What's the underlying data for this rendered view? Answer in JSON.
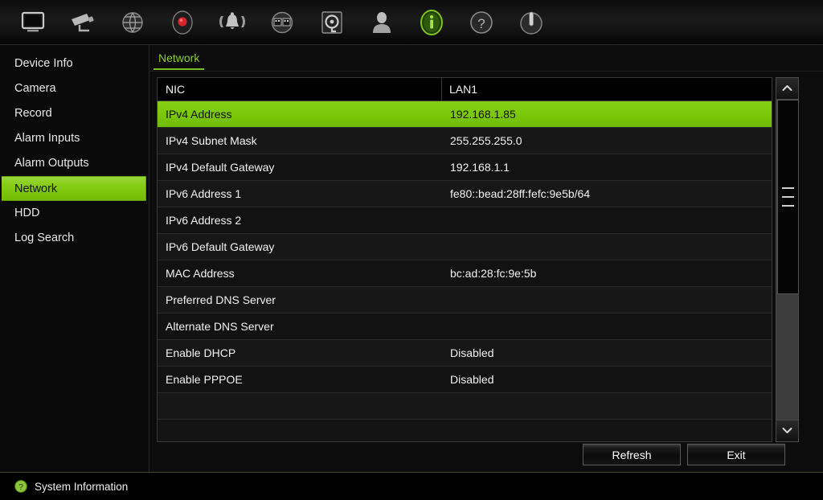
{
  "toolbar": {
    "items": [
      {
        "icon": "monitor-icon",
        "name": "live-view"
      },
      {
        "icon": "camera-icon",
        "name": "camera"
      },
      {
        "icon": "globe-icon",
        "name": "network-settings"
      },
      {
        "icon": "record-icon",
        "name": "record"
      },
      {
        "icon": "alarm-bell-icon",
        "name": "alarm"
      },
      {
        "icon": "playback-icon",
        "name": "playback"
      },
      {
        "icon": "hdd-icon",
        "name": "hdd"
      },
      {
        "icon": "user-icon",
        "name": "user"
      },
      {
        "icon": "info-icon",
        "name": "system-information",
        "active": true
      },
      {
        "icon": "help-icon",
        "name": "help"
      },
      {
        "icon": "power-icon",
        "name": "shutdown"
      }
    ]
  },
  "sidebar": {
    "items": [
      {
        "label": "Device Info",
        "active": false
      },
      {
        "label": "Camera",
        "active": false
      },
      {
        "label": "Record",
        "active": false
      },
      {
        "label": "Alarm Inputs",
        "active": false
      },
      {
        "label": "Alarm Outputs",
        "active": false
      },
      {
        "label": "Network",
        "active": true
      },
      {
        "label": "HDD",
        "active": false
      },
      {
        "label": "Log Search",
        "active": false
      }
    ]
  },
  "main": {
    "tab": {
      "label": "Network"
    },
    "table": {
      "header": {
        "key": "NIC",
        "value": "LAN1"
      },
      "rows": [
        {
          "key": "IPv4 Address",
          "value": "192.168.1.85",
          "selected": true
        },
        {
          "key": "IPv4 Subnet Mask",
          "value": "255.255.255.0",
          "selected": false
        },
        {
          "key": "IPv4 Default Gateway",
          "value": "192.168.1.1",
          "selected": false
        },
        {
          "key": "IPv6 Address 1",
          "value": "fe80::bead:28ff:fefc:9e5b/64",
          "selected": false
        },
        {
          "key": "IPv6 Address 2",
          "value": "",
          "selected": false
        },
        {
          "key": "IPv6 Default Gateway",
          "value": "",
          "selected": false
        },
        {
          "key": "MAC Address",
          "value": "bc:ad:28:fc:9e:5b",
          "selected": false
        },
        {
          "key": "Preferred DNS Server",
          "value": "",
          "selected": false
        },
        {
          "key": "Alternate DNS Server",
          "value": "",
          "selected": false
        },
        {
          "key": "Enable DHCP",
          "value": "Disabled",
          "selected": false
        },
        {
          "key": "Enable PPPOE",
          "value": "Disabled",
          "selected": false
        },
        {
          "key": "",
          "value": "",
          "selected": false
        }
      ]
    },
    "scrollbar": {
      "up_icon": "chevron-up-icon",
      "down_icon": "chevron-down-icon"
    },
    "buttons": {
      "refresh_label": "Refresh",
      "exit_label": "Exit"
    }
  },
  "statusbar": {
    "icon": "help-circle-icon",
    "text": "System Information"
  },
  "colors": {
    "accent_green": "#7cc80a",
    "tab_green": "#8ccc2e",
    "background": "#000000"
  }
}
